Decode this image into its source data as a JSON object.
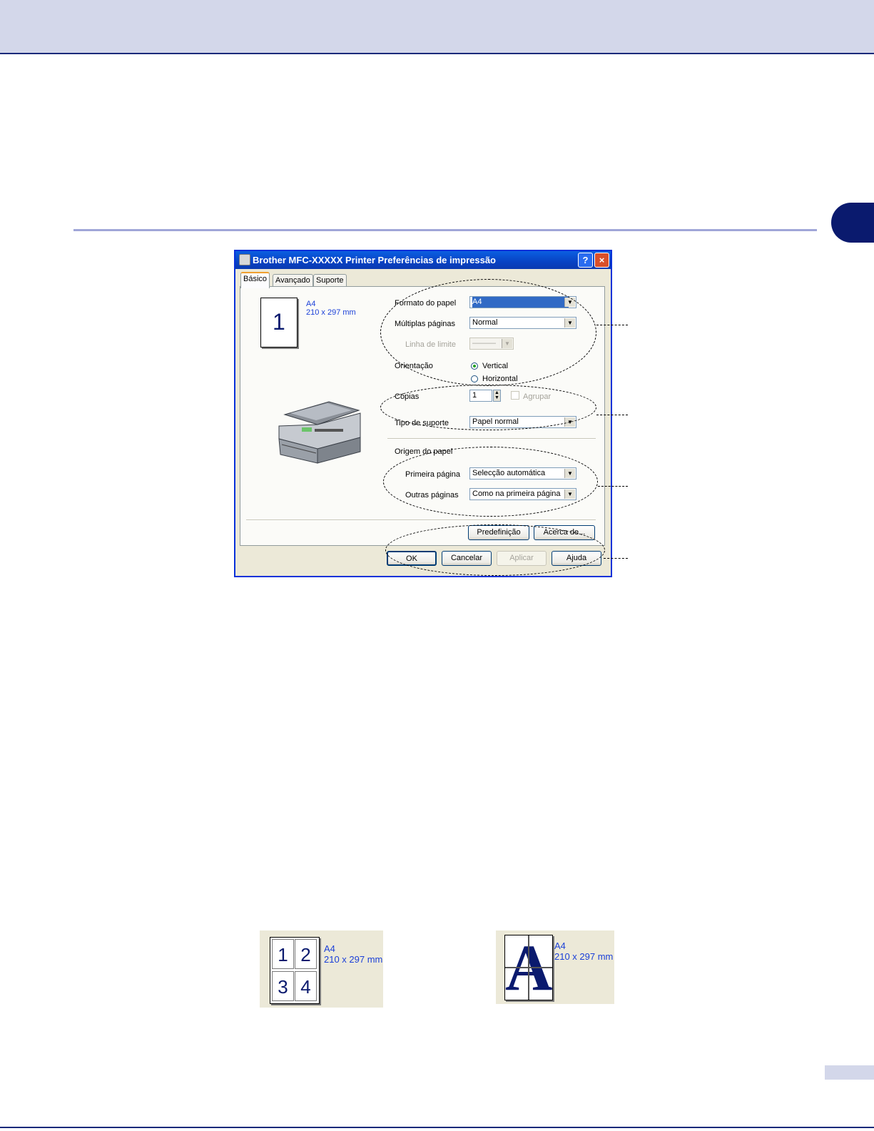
{
  "dialog": {
    "title": "Brother MFC-XXXXX Printer Preferências de impressão",
    "help_button": "?",
    "close_button": "×",
    "tabs": [
      "Básico",
      "Avançado",
      "Suporte"
    ],
    "preview": {
      "page_number": "1",
      "paper": "A4",
      "dimensions": "210 x 297 mm"
    },
    "fields": {
      "paper_size": {
        "label": "Formato do papel",
        "value": "A4"
      },
      "multiple_pages": {
        "label": "Múltiplas páginas",
        "value": "Normal"
      },
      "border_line": {
        "label": "Linha de limite",
        "value": "———"
      },
      "orientation": {
        "label": "Orientação",
        "options": [
          "Vertical",
          "Horizontal"
        ],
        "selected": "Vertical"
      },
      "copies": {
        "label": "Cópias",
        "value": "1",
        "collate_label": "Agrupar"
      },
      "media_type": {
        "label": "Tipo de suporte",
        "value": "Papel normal"
      },
      "paper_source": {
        "label": "Origem do papel",
        "first_page_label": "Primeira página",
        "first_page_value": "Selecção automática",
        "other_pages_label": "Outras páginas",
        "other_pages_value": "Como na primeira página"
      }
    },
    "buttons": {
      "default": "Predefinição",
      "about": "Acerca de...",
      "ok": "OK",
      "cancel": "Cancelar",
      "apply": "Aplicar",
      "help": "Ajuda"
    }
  },
  "thumbnails": [
    {
      "cells": [
        "1",
        "2",
        "3",
        "4"
      ],
      "paper": "A4",
      "dimensions": "210 x 297 mm"
    },
    {
      "letter": "A",
      "paper": "A4",
      "dimensions": "210 x 297 mm"
    }
  ],
  "colors": {
    "header_band": "#d3d7ea",
    "accent_navy": "#0a1a6e",
    "dialog_bg": "#ece9d8",
    "title_blue": "#0842c4"
  }
}
